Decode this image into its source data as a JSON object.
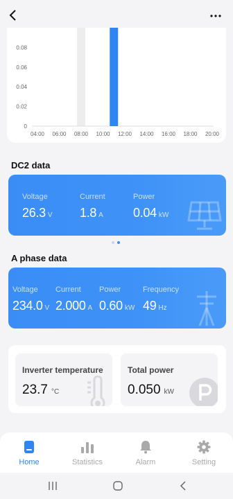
{
  "chart_data": {
    "type": "bar",
    "title": "",
    "xlabel": "",
    "ylabel": "",
    "x_ticks": [
      "04:00",
      "06:00",
      "08:00",
      "10:00",
      "12:00",
      "14:00",
      "16:00",
      "18:00",
      "20:00"
    ],
    "y_ticks": [
      "0",
      "0.02",
      "0.04",
      "0.06",
      "0.08"
    ],
    "ylim": [
      0,
      0.1
    ],
    "bars": [
      {
        "time": "11:00",
        "value": 0.1,
        "color": "#2f86f2"
      }
    ],
    "highlight_band": {
      "time": "08:00",
      "color": "#ededed"
    }
  },
  "dc2": {
    "title": "DC2 data",
    "metrics": [
      {
        "label": "Voltage",
        "value": "26.3",
        "unit": "V"
      },
      {
        "label": "Current",
        "value": "1.8",
        "unit": "A"
      },
      {
        "label": "Power",
        "value": "0.04",
        "unit": "kW"
      }
    ],
    "icon": "solar-panel-icon"
  },
  "pager": {
    "count": 2,
    "active_index": 1
  },
  "a_phase": {
    "title": "A phase data",
    "metrics": [
      {
        "label": "Voltage",
        "value": "234.0",
        "unit": "V"
      },
      {
        "label": "Current",
        "value": "2.000",
        "unit": "A"
      },
      {
        "label": "Power",
        "value": "0.60",
        "unit": "kW"
      },
      {
        "label": "Frequency",
        "value": "49",
        "unit": "Hz"
      }
    ],
    "icon": "power-pole-icon"
  },
  "stats": {
    "temperature": {
      "label": "Inverter temperature",
      "value": "23.7",
      "unit": "°C",
      "icon": "thermometer-icon"
    },
    "total_power": {
      "label": "Total power",
      "value": "0.050",
      "unit": "kW",
      "icon": "parking-p-icon"
    }
  },
  "tabs": [
    {
      "label": "Home",
      "icon": "home-icon",
      "active": true
    },
    {
      "label": "Statistics",
      "icon": "bar-chart-icon",
      "active": false
    },
    {
      "label": "Alarm",
      "icon": "bell-icon",
      "active": false
    },
    {
      "label": "Setting",
      "icon": "gear-icon",
      "active": false
    }
  ],
  "colors": {
    "accent": "#2f86f2",
    "card_blue": "#3a8df5",
    "background": "#f4f4f6"
  }
}
